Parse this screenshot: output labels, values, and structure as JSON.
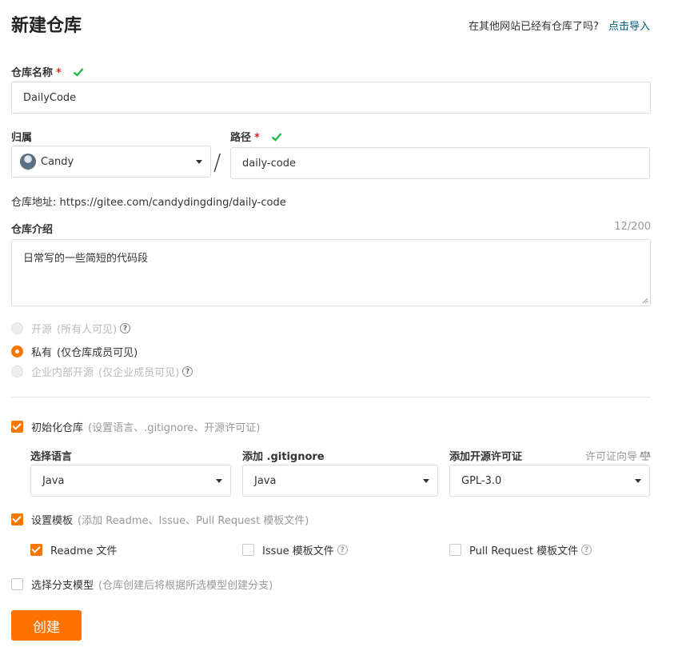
{
  "header": {
    "title": "新建仓库",
    "import_prompt": "在其他网站已经有仓库了吗?",
    "import_link": "点击导入"
  },
  "repo_name": {
    "label": "仓库名称",
    "required_mark": "*",
    "value": "DailyCode"
  },
  "owner": {
    "label": "归属",
    "value": "Candy"
  },
  "path": {
    "label": "路径",
    "required_mark": "*",
    "separator": "/",
    "value": "daily-code"
  },
  "repo_url": {
    "label": "仓库地址:",
    "value": "https://gitee.com/candydingding/daily-code"
  },
  "description": {
    "label": "仓库介绍",
    "counter": "12/200",
    "value": "日常写的一些简短的代码段"
  },
  "visibility": {
    "options": [
      {
        "label": "开源",
        "hint": "(所有人可见)",
        "selected": false,
        "disabled": true
      },
      {
        "label": "私有",
        "hint": "(仅仓库成员可见)",
        "selected": true,
        "disabled": false
      },
      {
        "label": "企业内部开源",
        "hint": "(仅企业成员可见)",
        "selected": false,
        "disabled": true
      }
    ]
  },
  "init_repo": {
    "label": "初始化仓库",
    "hint": "(设置语言、.gitignore、开源许可证)",
    "checked": true
  },
  "language": {
    "label": "选择语言",
    "value": "Java"
  },
  "gitignore": {
    "label": "添加 .gitignore",
    "value": "Java"
  },
  "license": {
    "label": "添加开源许可证",
    "wizard": "许可证向导",
    "value": "GPL-3.0"
  },
  "template": {
    "label": "设置模板",
    "hint": "(添加 Readme、Issue、Pull Request 模板文件)",
    "checked": true,
    "items": [
      {
        "label": "Readme 文件",
        "checked": true
      },
      {
        "label": "Issue 模板文件",
        "checked": false
      },
      {
        "label": "Pull Request 模板文件",
        "checked": false
      }
    ]
  },
  "branch_model": {
    "label": "选择分支模型",
    "hint": "(仓库创建后将根据所选模型创建分支)",
    "checked": false
  },
  "submit": {
    "label": "创建"
  },
  "colors": {
    "accent": "#fe7300",
    "link": "#005980",
    "success": "#21ba45",
    "required": "#db2828"
  },
  "icons": {
    "valid": "checkmark-icon",
    "help": "question-circle-icon",
    "dropdown": "caret-down-icon",
    "wizard": "balance-scale-icon"
  }
}
